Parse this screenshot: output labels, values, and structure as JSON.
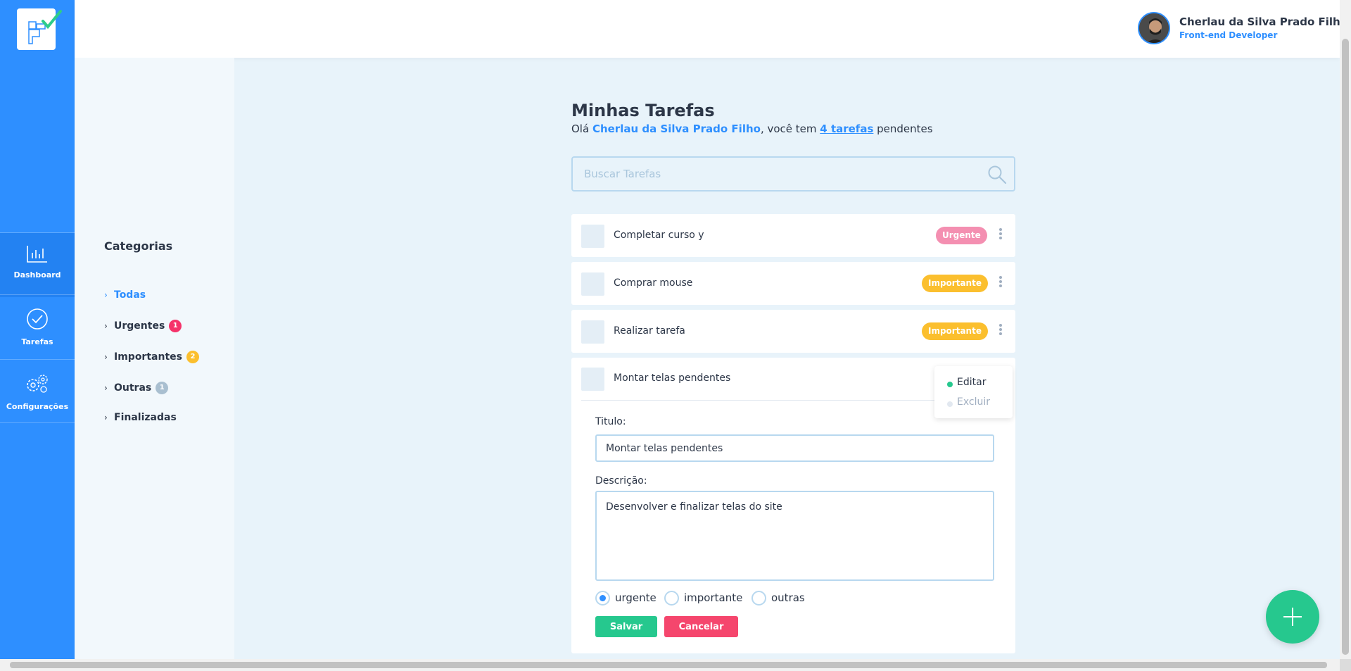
{
  "nav": {
    "items": [
      {
        "label": "Dashboard",
        "icon": "bar-chart-icon"
      },
      {
        "label": "Tarefas",
        "icon": "check-circle-icon"
      },
      {
        "label": "Configurações",
        "icon": "gears-icon"
      }
    ]
  },
  "header": {
    "user_name": "Cherlau da Silva Prado Filho",
    "user_role": "Front-end Developer"
  },
  "categories": {
    "title": "Categorias",
    "items": [
      {
        "label": "Todas"
      },
      {
        "label": "Urgentes",
        "count": "1"
      },
      {
        "label": "Importantes",
        "count": "2"
      },
      {
        "label": "Outras",
        "count": "1"
      },
      {
        "label": "Finalizadas"
      }
    ]
  },
  "main": {
    "title": "Minhas Tarefas",
    "greeting_prefix": "Olá ",
    "greeting_name": "Cherlau da Silva Prado Filho",
    "greeting_middle": ", você tem ",
    "greeting_count": "4 tarefas",
    "greeting_suffix": " pendentes",
    "search_placeholder": "Buscar Tarefas"
  },
  "tasks": [
    {
      "title": "Completar curso y",
      "tag": "Urgente"
    },
    {
      "title": "Comprar mouse",
      "tag": "Importante"
    },
    {
      "title": "Realizar tarefa",
      "tag": "Importante"
    },
    {
      "title": "Montar telas pendentes"
    }
  ],
  "menu": {
    "edit": "Editar",
    "delete": "Excluir"
  },
  "form": {
    "title_label": "Titulo:",
    "title_value": "Montar telas pendentes",
    "desc_label": "Descrição:",
    "desc_value": "Desenvolver e finalizar telas do site",
    "radios": [
      "urgente",
      "importante",
      "outras"
    ],
    "selected": "urgente",
    "save": "Salvar",
    "cancel": "Cancelar"
  },
  "colors": {
    "primary": "#2e8fff",
    "urgent": "#f48fb1",
    "urgent_badge": "#f5336a",
    "important": "#fbbf2e",
    "other": "#a9bfd0",
    "success": "#26c88e",
    "danger": "#f5466d"
  }
}
